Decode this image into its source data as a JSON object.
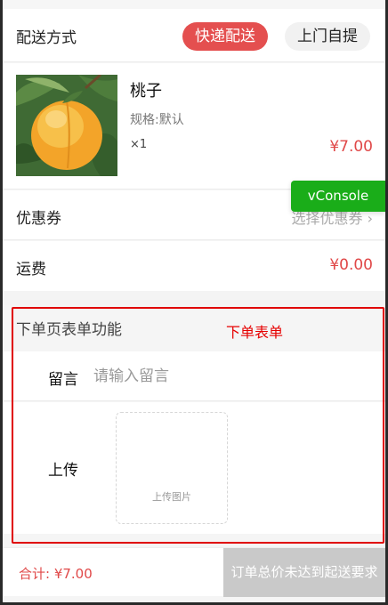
{
  "delivery": {
    "label": "配送方式",
    "options": [
      "快递配送",
      "上门自提"
    ],
    "selected": "快递配送"
  },
  "product": {
    "name": "桃子",
    "spec": "规格:默认",
    "qty": "×1",
    "price": "¥7.00"
  },
  "coupon": {
    "label": "优惠券",
    "value": "选择优惠券 ›"
  },
  "vconsole": {
    "label": "vConsole"
  },
  "shipping": {
    "label": "运费",
    "value": "¥0.00"
  },
  "order_form": {
    "title": "下单页表单功能",
    "annotation": "下单表单",
    "message_label": "留言",
    "message_placeholder": "请输入留言",
    "message_value": "",
    "upload_label": "上传",
    "upload_button": "上传图片"
  },
  "footer": {
    "total": "合计: ¥7.00",
    "submit_label": "订单总价未达到起送要求"
  },
  "colors": {
    "accent_red": "#e44f4f",
    "price_red": "#e04848",
    "annotation_red": "#e00000",
    "vconsole_green": "#1aad19",
    "disabled_gray": "#c9c9c9"
  }
}
